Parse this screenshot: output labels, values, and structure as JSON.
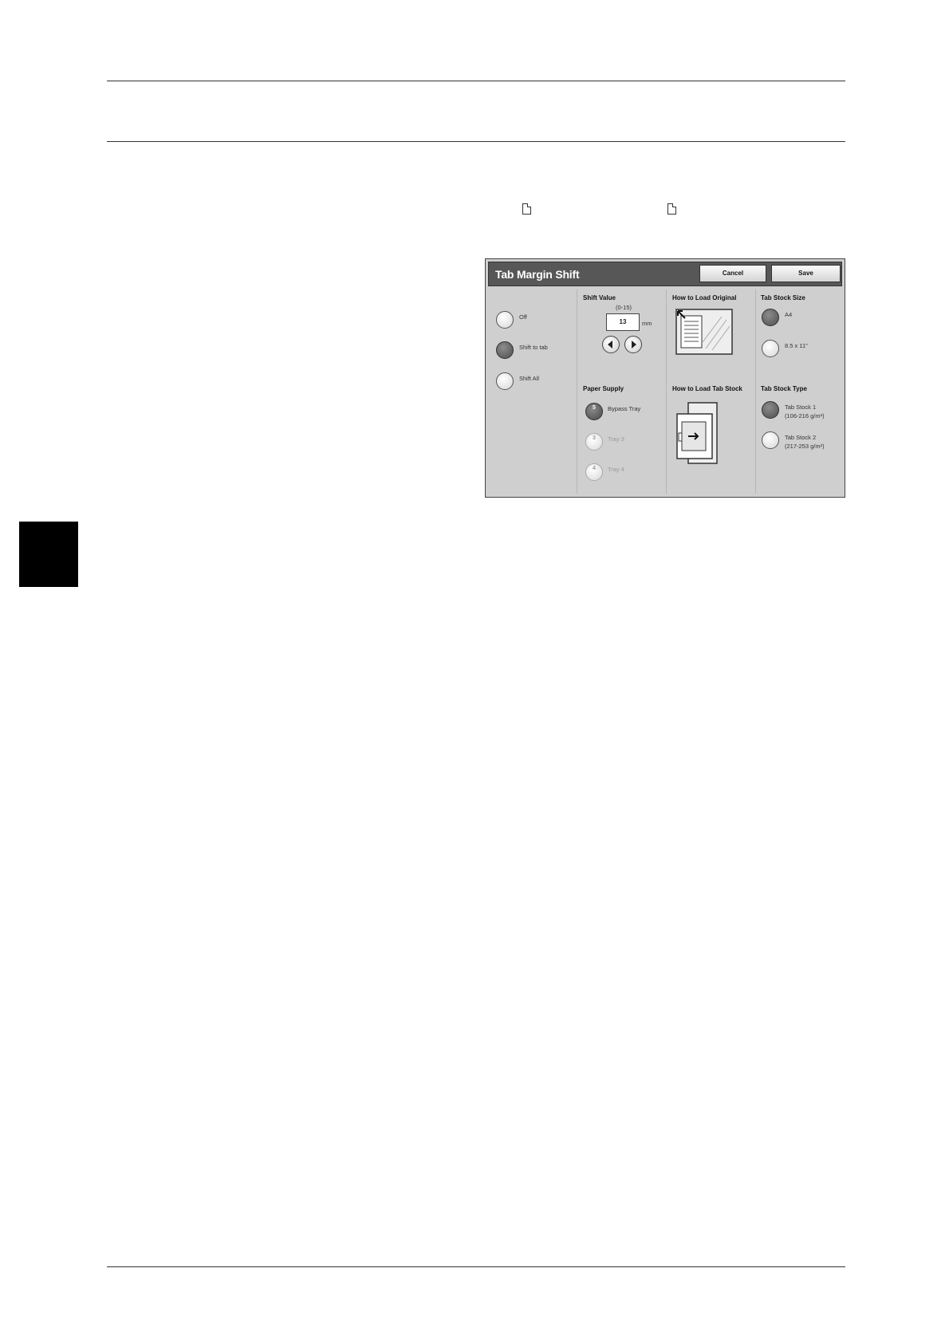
{
  "panel": {
    "title": "Tab Margin Shift",
    "cancel_label": "Cancel",
    "save_label": "Save",
    "shift_options": [
      {
        "label": "Off",
        "selected": false
      },
      {
        "label": "Shift to tab",
        "selected": true
      },
      {
        "label": "Shift All",
        "selected": false
      }
    ],
    "shift_value": {
      "label": "Shift Value",
      "range": "(0-15)",
      "value": "13",
      "unit": "mm"
    },
    "paper_supply": {
      "label": "Paper Supply",
      "trays": [
        {
          "number": "5",
          "label": "Bypass Tray",
          "selected": true,
          "enabled": true
        },
        {
          "number": "3",
          "label": "Tray 3",
          "selected": false,
          "enabled": false
        },
        {
          "number": "4",
          "label": "Tray 4",
          "selected": false,
          "enabled": false
        }
      ]
    },
    "how_to_load_original": "How to Load Original",
    "how_to_load_tab_stock": "How to Load Tab Stock",
    "tab_stock_size": {
      "label": "Tab Stock Size",
      "options": [
        {
          "label": "A4",
          "selected": true
        },
        {
          "label": "8.5 x 11\"",
          "selected": false
        }
      ]
    },
    "tab_stock_type": {
      "label": "Tab Stock Type",
      "options": [
        {
          "line1": "Tab Stock 1",
          "line2": "(106-216 g/m²)",
          "selected": true
        },
        {
          "line1": "Tab Stock 2",
          "line2": "(217-253 g/m²)",
          "selected": false
        }
      ]
    }
  }
}
